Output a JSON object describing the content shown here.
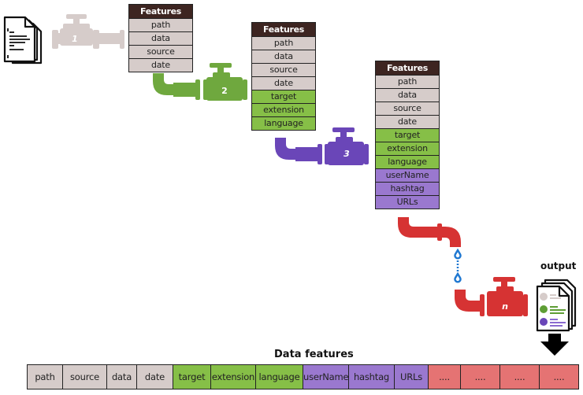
{
  "pipeline_stages": [
    {
      "stage_label": "1",
      "color": "#d6ccca",
      "table": {
        "header": "Features",
        "rows": [
          {
            "label": "path",
            "group": "beige"
          },
          {
            "label": "data",
            "group": "beige"
          },
          {
            "label": "source",
            "group": "beige"
          },
          {
            "label": "date",
            "group": "beige"
          }
        ]
      }
    },
    {
      "stage_label": "2",
      "color": "#6fa83e",
      "table": {
        "header": "Features",
        "rows": [
          {
            "label": "path",
            "group": "beige"
          },
          {
            "label": "data",
            "group": "beige"
          },
          {
            "label": "source",
            "group": "beige"
          },
          {
            "label": "date",
            "group": "beige"
          },
          {
            "label": "target",
            "group": "green"
          },
          {
            "label": "extension",
            "group": "green"
          },
          {
            "label": "language",
            "group": "green"
          }
        ]
      }
    },
    {
      "stage_label": "3",
      "color": "#6a46b8",
      "table": {
        "header": "Features",
        "rows": [
          {
            "label": "path",
            "group": "beige"
          },
          {
            "label": "data",
            "group": "beige"
          },
          {
            "label": "source",
            "group": "beige"
          },
          {
            "label": "date",
            "group": "beige"
          },
          {
            "label": "target",
            "group": "green"
          },
          {
            "label": "extension",
            "group": "green"
          },
          {
            "label": "language",
            "group": "green"
          },
          {
            "label": "userName",
            "group": "purple"
          },
          {
            "label": "hashtag",
            "group": "purple"
          },
          {
            "label": "URLs",
            "group": "purple"
          }
        ]
      }
    },
    {
      "stage_label": "n",
      "color": "#d63333"
    }
  ],
  "output_label": "output",
  "data_features": {
    "title": "Data features",
    "cells": [
      {
        "label": "path",
        "group": "beige"
      },
      {
        "label": "source",
        "group": "beige"
      },
      {
        "label": "data",
        "group": "beige"
      },
      {
        "label": "date",
        "group": "beige"
      },
      {
        "label": "target",
        "group": "green"
      },
      {
        "label": "extension",
        "group": "green"
      },
      {
        "label": "language",
        "group": "green"
      },
      {
        "label": "userName",
        "group": "purple"
      },
      {
        "label": "hashtag",
        "group": "purple"
      },
      {
        "label": "URLs",
        "group": "purple"
      },
      {
        "label": "....",
        "group": "red"
      },
      {
        "label": "....",
        "group": "red"
      },
      {
        "label": "....",
        "group": "red"
      },
      {
        "label": "....",
        "group": "red"
      }
    ]
  },
  "colors": {
    "beige": "#d6ccca",
    "green": "#86bf47",
    "purple": "#9a78cf",
    "red": "#e57373",
    "header": "#3d2521",
    "drop": "#1f78d1"
  }
}
